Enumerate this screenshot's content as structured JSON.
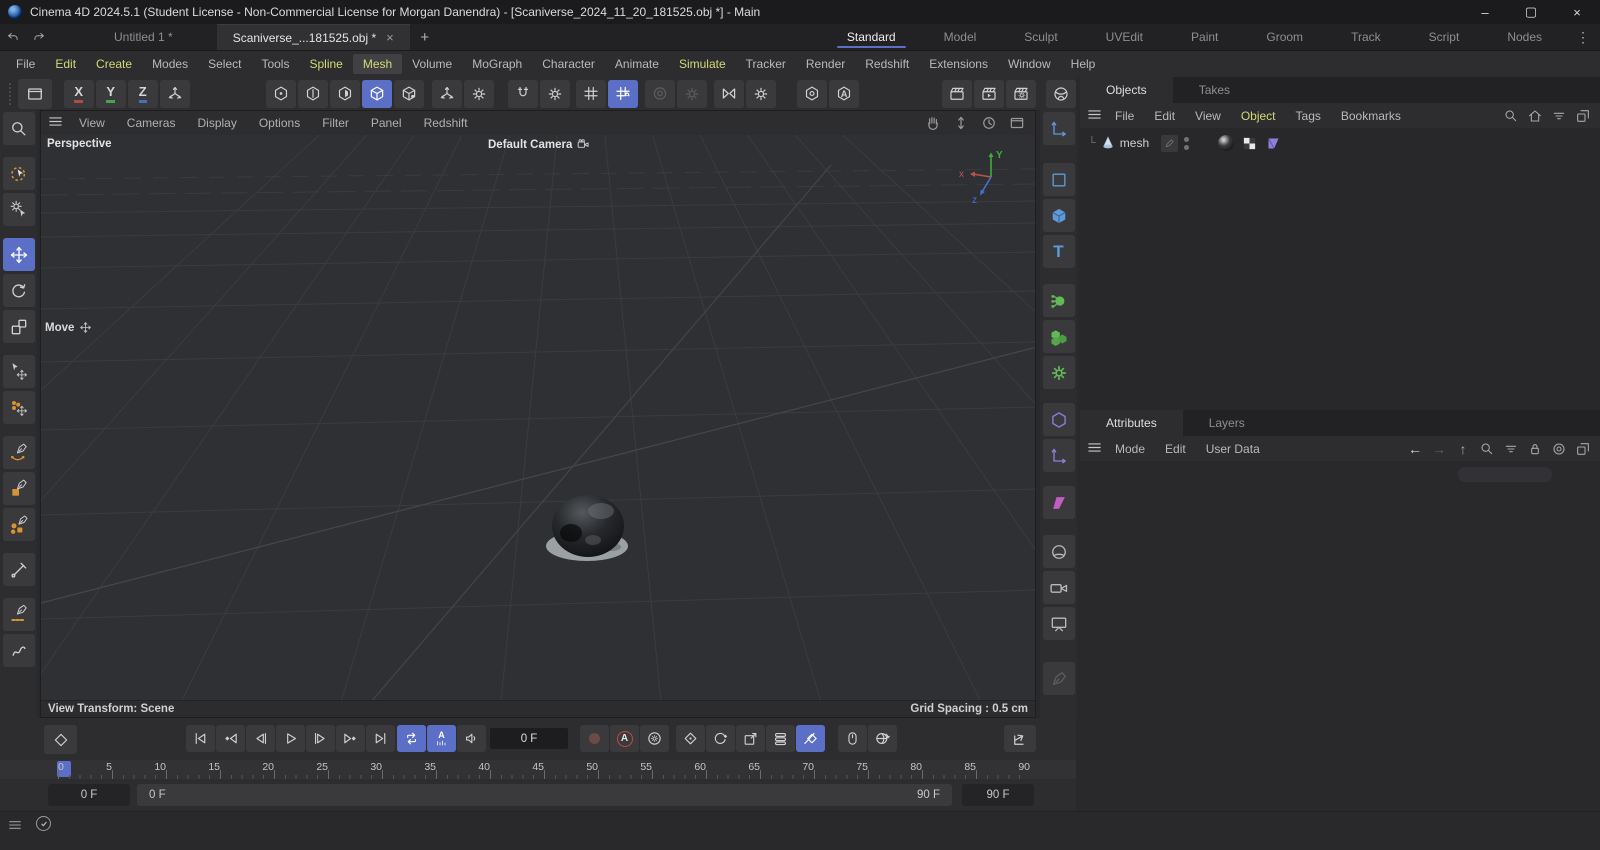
{
  "titlebar": {
    "app_title": "Cinema 4D 2024.5.1 (Student License - Non-Commercial License for Morgan Danendra) - [Scaniverse_2024_11_20_181525.obj *] - Main",
    "minimize": "–",
    "maximize": "▢",
    "close": "×"
  },
  "document_tabs": {
    "items": [
      {
        "label": "Untitled 1 *",
        "active": false
      },
      {
        "label": "Scaniverse_...181525.obj *",
        "active": true
      }
    ],
    "close_tab": "×",
    "new_tab": "+"
  },
  "workspaces": {
    "items": [
      {
        "label": "Standard",
        "active": true
      },
      {
        "label": "Model"
      },
      {
        "label": "Sculpt"
      },
      {
        "label": "UVEdit"
      },
      {
        "label": "Paint"
      },
      {
        "label": "Groom"
      },
      {
        "label": "Track"
      },
      {
        "label": "Script"
      },
      {
        "label": "Nodes"
      }
    ],
    "more": "⋮"
  },
  "menubar": {
    "items": [
      {
        "label": "File"
      },
      {
        "label": "Edit",
        "accent": true
      },
      {
        "label": "Create",
        "accent": true
      },
      {
        "label": "Modes"
      },
      {
        "label": "Select"
      },
      {
        "label": "Tools"
      },
      {
        "label": "Spline",
        "accent": true
      },
      {
        "label": "Mesh",
        "accent": true,
        "selected": true
      },
      {
        "label": "Volume"
      },
      {
        "label": "MoGraph"
      },
      {
        "label": "Character"
      },
      {
        "label": "Animate"
      },
      {
        "label": "Simulate",
        "accent": true
      },
      {
        "label": "Tracker"
      },
      {
        "label": "Render"
      },
      {
        "label": "Redshift"
      },
      {
        "label": "Extensions"
      },
      {
        "label": "Window"
      },
      {
        "label": "Help"
      }
    ]
  },
  "toolbar": {
    "x": "X",
    "y": "Y",
    "z": "Z",
    "auto_letter": "A"
  },
  "viewport": {
    "menu": [
      {
        "label": "View"
      },
      {
        "label": "Cameras"
      },
      {
        "label": "Display"
      },
      {
        "label": "Options"
      },
      {
        "label": "Filter"
      },
      {
        "label": "Panel"
      },
      {
        "label": "Redshift"
      }
    ],
    "view_label": "Perspective",
    "camera_label": "Default Camera",
    "tool_hint": "Move",
    "status_left": "View Transform: Scene",
    "status_right": "Grid Spacing : 0.5 cm",
    "axis": {
      "x": "x",
      "y": "Y",
      "z": "z"
    }
  },
  "object_manager": {
    "tabs": [
      {
        "label": "Objects",
        "active": true
      },
      {
        "label": "Takes"
      }
    ],
    "menu": [
      {
        "label": "File"
      },
      {
        "label": "Edit"
      },
      {
        "label": "View"
      },
      {
        "label": "Object",
        "accent": true
      },
      {
        "label": "Tags"
      },
      {
        "label": "Bookmarks"
      }
    ],
    "objects": [
      {
        "name": "mesh"
      }
    ]
  },
  "attribute_manager": {
    "tabs": [
      {
        "label": "Attributes",
        "active": true
      },
      {
        "label": "Layers"
      }
    ],
    "menu": [
      {
        "label": "Mode"
      },
      {
        "label": "Edit"
      },
      {
        "label": "User Data"
      }
    ]
  },
  "timeline": {
    "current_frame": "0 F",
    "ruler_labels": [
      "0",
      "5",
      "10",
      "15",
      "20",
      "25",
      "30",
      "35",
      "40",
      "45",
      "50",
      "55",
      "60",
      "65",
      "70",
      "75",
      "80",
      "85",
      "90"
    ],
    "range": {
      "start_field": "0 F",
      "bar_start": "0 F",
      "bar_end": "90 F",
      "end_field": "90 F"
    }
  },
  "colors": {
    "accent_blue": "#5c6fc7",
    "accent_yellow": "#d3d878",
    "axis_x": "#c0504d",
    "axis_y": "#4ca04a",
    "axis_z": "#4a6fd4"
  }
}
